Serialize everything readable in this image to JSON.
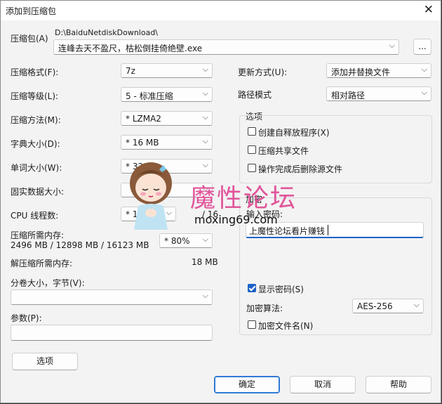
{
  "window": {
    "title": "添加到压缩包",
    "close_icon": "✕"
  },
  "archive": {
    "label": "压缩包(A)",
    "path": "D:\\BaiduNetdiskDownload\\",
    "filename": "连峰去天不盈尺，枯松倒挂倚绝壁.exe",
    "browse_label": "..."
  },
  "left": {
    "format": {
      "label": "压缩格式(F):",
      "value": "7z"
    },
    "level": {
      "label": "压缩等级(L):",
      "value": "5 - 标准压缩"
    },
    "method": {
      "label": "压缩方法(M):",
      "value": "*  LZMA2"
    },
    "dict": {
      "label": "字典大小(D):",
      "value": "*  16 MB"
    },
    "word": {
      "label": "单词大小(W):",
      "value": "*  32"
    },
    "solid": {
      "label": "固实数据大小:",
      "value": ""
    },
    "cpu": {
      "label": "CPU 线程数:",
      "value": "*  16",
      "max": "/ 16"
    },
    "mem": {
      "label": "压缩所需内存:",
      "value": "2496 MB / 12898 MB / 16123 MB",
      "pct": "*  80%"
    },
    "dmem": {
      "label": "解压缩所需内存:",
      "value": "18 MB"
    },
    "volume": {
      "label": "分卷大小，字节(V):",
      "value": ""
    },
    "params": {
      "label": "参数(P):",
      "value": ""
    },
    "options_btn": "选项"
  },
  "right": {
    "update": {
      "label": "更新方式(U):",
      "value": "添加并替换文件"
    },
    "pathmode": {
      "label": "路径模式",
      "value": "相对路径"
    },
    "options": {
      "title": "选项",
      "items": [
        {
          "label": "创建自释放程序(X)",
          "checked": false
        },
        {
          "label": "压缩共享文件",
          "checked": false
        },
        {
          "label": "操作完成后删除源文件",
          "checked": false
        }
      ]
    },
    "encrypt": {
      "title": "加密",
      "pw_label": "输入密码:",
      "pw_value": "上魔性论坛看片赚钱",
      "show_pw": {
        "label": "显示密码(S)",
        "checked": true
      },
      "method_label": "加密算法:",
      "method_value": "AES-256",
      "encnames": {
        "label": "加密文件名(N)",
        "checked": false
      }
    }
  },
  "buttons": {
    "ok": "确定",
    "cancel": "取消",
    "help": "帮助"
  },
  "watermark": {
    "text": "魔性论坛",
    "url": "moxing69.com"
  },
  "icons": {
    "chevron": "⌵"
  }
}
